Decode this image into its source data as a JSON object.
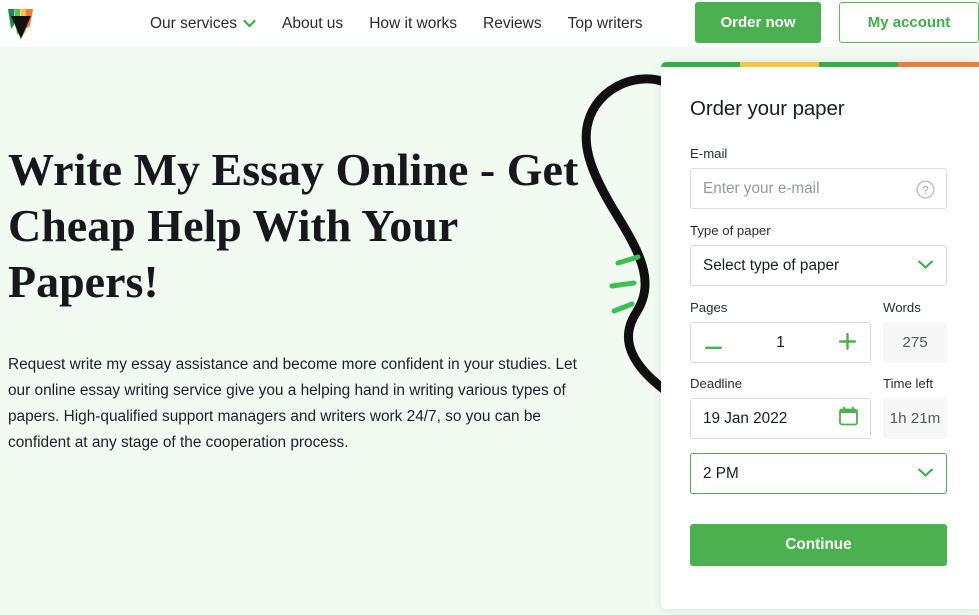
{
  "header": {
    "logo_icon": "funnel-logo-icon",
    "nav_items": [
      {
        "label": "Our services",
        "has_chevron": true
      },
      {
        "label": "About us",
        "has_chevron": false
      },
      {
        "label": "How it works",
        "has_chevron": false
      },
      {
        "label": "Reviews",
        "has_chevron": false
      },
      {
        "label": "Top writers",
        "has_chevron": false
      }
    ],
    "order_now_label": "Order now",
    "my_account_label": "My account"
  },
  "hero": {
    "headline": "Write My Essay Online - Get Cheap Help With Your Papers!",
    "paragraph": "Request write my essay assistance and become more confident in your studies. Let our online essay writing service give you a helping hand in writing various types of papers. High-qualified support managers and writers work 24/7, so you can be confident at any stage of the cooperation process.",
    "background_color": "#f1fbf2",
    "decoration": "squiggle-curve-with-green-dashes"
  },
  "order_form": {
    "title": "Order your paper",
    "stripe_colors": [
      "#3aab4d",
      "#f2c744",
      "#3aab4d",
      "#ef7d3a"
    ],
    "email": {
      "label": "E-mail",
      "placeholder": "Enter your e-mail",
      "value": "",
      "help_icon": "question-circle-icon"
    },
    "type_of_paper": {
      "label": "Type of paper",
      "selected": "Select type of paper",
      "chevron_icon": "chevron-down-icon"
    },
    "pages": {
      "label": "Pages",
      "value": "1",
      "decrement_icon": "minus-icon",
      "increment_icon": "plus-icon"
    },
    "words": {
      "label": "Words",
      "value": "275"
    },
    "deadline": {
      "label": "Deadline",
      "value": "19 Jan 2022",
      "calendar_icon": "calendar-icon"
    },
    "time_left": {
      "label": "Time left",
      "value": "1h 21m"
    },
    "time_select": {
      "selected": "2 PM",
      "chevron_icon": "chevron-down-icon"
    },
    "continue_label": "Continue",
    "accent_color": "#4caf50"
  }
}
